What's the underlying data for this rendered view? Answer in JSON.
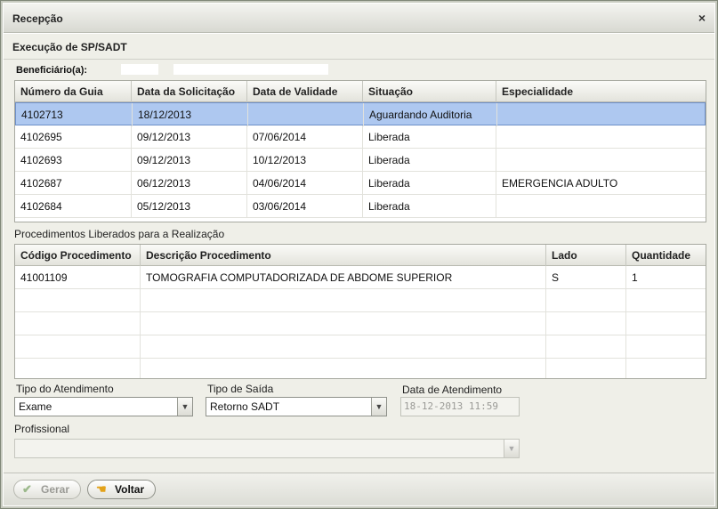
{
  "window": {
    "title": "Recepção",
    "close_glyph": "×"
  },
  "section": {
    "title": "Execução de SP/SADT"
  },
  "beneficiary": {
    "label": "Beneficiário(a):"
  },
  "guides": {
    "columns": [
      "Número da Guia",
      "Data da Solicitação",
      "Data de Validade",
      "Situação",
      "Especialidade"
    ],
    "rows": [
      [
        "4102713",
        "18/12/2013",
        "",
        "Aguardando Auditoria",
        ""
      ],
      [
        "4102695",
        "09/12/2013",
        "07/06/2014",
        "Liberada",
        ""
      ],
      [
        "4102693",
        "09/12/2013",
        "10/12/2013",
        "Liberada",
        ""
      ],
      [
        "4102687",
        "06/12/2013",
        "04/06/2014",
        "Liberada",
        "EMERGENCIA ADULTO"
      ],
      [
        "4102684",
        "05/12/2013",
        "03/06/2014",
        "Liberada",
        ""
      ]
    ],
    "selected_row": 0
  },
  "procedures": {
    "label": "Procedimentos Liberados para a Realização",
    "columns": [
      "Código Procedimento",
      "Descrição Procedimento",
      "Lado",
      "Quantidade"
    ],
    "rows": [
      [
        "41001109",
        "TOMOGRAFIA COMPUTADORIZADA DE ABDOME SUPERIOR",
        "S",
        "1"
      ],
      [
        "",
        "",
        "",
        ""
      ],
      [
        "",
        "",
        "",
        ""
      ],
      [
        "",
        "",
        "",
        ""
      ],
      [
        "",
        "",
        "",
        ""
      ]
    ]
  },
  "form": {
    "tipo_atendimento": {
      "label": "Tipo do Atendimento",
      "value": "Exame"
    },
    "tipo_saida": {
      "label": "Tipo de Saída",
      "value": "Retorno SADT"
    },
    "data_atendimento": {
      "label": "Data de Atendimento",
      "value": "18-12-2013 11:59"
    },
    "profissional": {
      "label": "Profissional",
      "value": ""
    }
  },
  "buttons": {
    "gerar": {
      "label": "Gerar",
      "icon": "checkmark-icon"
    },
    "voltar": {
      "label": "Voltar",
      "icon": "back-hand-icon"
    }
  },
  "colors": {
    "selected_row": "#aec8f0",
    "selected_border": "#6d8fc8"
  }
}
